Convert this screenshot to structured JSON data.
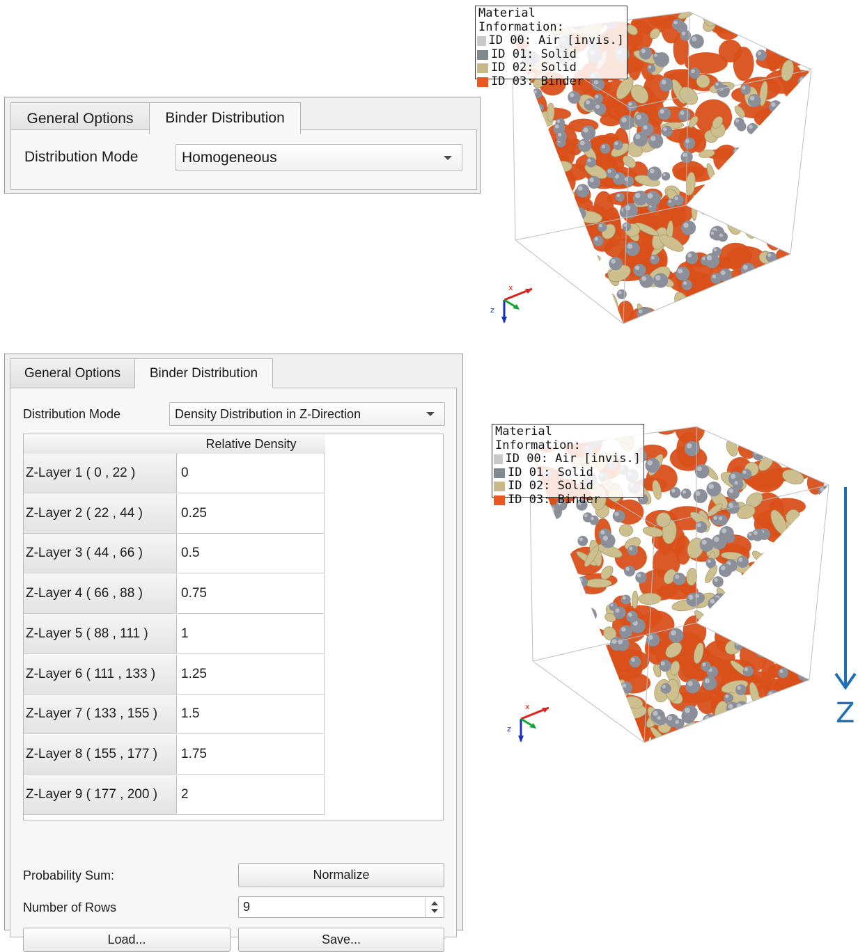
{
  "top_panel": {
    "tabs": [
      "General Options",
      "Binder Distribution"
    ],
    "active_tab": "Binder Distribution",
    "distribution_mode_label": "Distribution Mode",
    "distribution_mode_value": "Homogeneous"
  },
  "bottom_panel": {
    "tabs": [
      "General Options",
      "Binder Distribution"
    ],
    "active_tab": "Binder Distribution",
    "distribution_mode_label": "Distribution Mode",
    "distribution_mode_value": "Density Distribution in Z-Direction",
    "table_header": "Relative Density",
    "rows": [
      {
        "label": "Z-Layer 1 ( 0 , 22 )",
        "value": "0"
      },
      {
        "label": "Z-Layer 2 ( 22 , 44 )",
        "value": "0.25"
      },
      {
        "label": "Z-Layer 3 ( 44 , 66 )",
        "value": "0.5"
      },
      {
        "label": "Z-Layer 4 ( 66 , 88 )",
        "value": "0.75"
      },
      {
        "label": "Z-Layer 5 ( 88 , 111 )",
        "value": "1"
      },
      {
        "label": "Z-Layer 6 ( 111 , 133 )",
        "value": "1.25"
      },
      {
        "label": "Z-Layer 7 ( 133 , 155 )",
        "value": "1.5"
      },
      {
        "label": "Z-Layer 8 ( 155 , 177 )",
        "value": "1.75"
      },
      {
        "label": "Z-Layer 9 ( 177 , 200 )",
        "value": "2"
      }
    ],
    "probability_sum_label": "Probability Sum:",
    "normalize_label": "Normalize",
    "number_of_rows_label": "Number of Rows",
    "number_of_rows_value": "9",
    "load_label": "Load...",
    "save_label": "Save..."
  },
  "legend": {
    "title": "Material Information:",
    "items": [
      {
        "text": "ID 00: Air [invis.]",
        "color": "#c8c8c8"
      },
      {
        "text": "ID 01: Solid",
        "color": "#808890"
      },
      {
        "text": "ID 02: Solid",
        "color": "#c9b98a"
      },
      {
        "text": "ID 03: Binder",
        "color": "#e8581f"
      }
    ]
  },
  "z_arrow_label": "Z",
  "colors": {
    "binder": "#d9501a",
    "solid_sphere": "#8a8f99",
    "solid_ellipsoid": "#cdbf8e",
    "z_arrow": "#1f6fb8"
  },
  "icons": [
    "axis-triad-icon",
    "dropdown-arrow-icon",
    "spin-up-icon",
    "spin-down-icon"
  ]
}
